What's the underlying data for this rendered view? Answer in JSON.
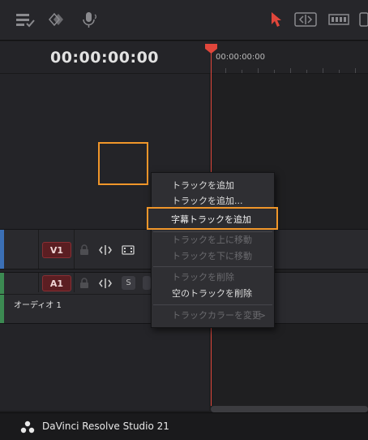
{
  "toolbar": {
    "icons": [
      "timeline-view-options-icon",
      "keyframe-diamond-icon",
      "voice-over-mic-icon",
      "selection-pointer-icon",
      "trim-edit-icon",
      "dynamic-trim-icon",
      "blade-icon"
    ]
  },
  "viewer": {
    "timecode": "00:00:00:00",
    "ruler_start_timecode": "00:00:00:00"
  },
  "tracks": {
    "video": {
      "badge": "V1",
      "color": "#3b6fb5"
    },
    "audio": {
      "badge": "A1",
      "solo_label": "S",
      "name": "オーディオ 1",
      "color": "#3c8a52"
    }
  },
  "context_menu": {
    "items": [
      {
        "label": "トラックを追加",
        "enabled": true
      },
      {
        "label": "トラックを追加...",
        "enabled": true
      },
      {
        "label": "字幕トラックを追加",
        "enabled": true,
        "highlighted": true
      },
      {
        "label": "トラックを上に移動",
        "enabled": false
      },
      {
        "label": "トラックを下に移動",
        "enabled": false
      },
      {
        "label": "トラックを削除",
        "enabled": false
      },
      {
        "label": "空のトラックを削除",
        "enabled": true
      },
      {
        "label": "トラックカラーを変更",
        "enabled": false
      }
    ],
    "submenu_arrow": ">"
  },
  "status_bar": {
    "app_name": "DaVinci Resolve Studio 21"
  },
  "colors": {
    "accent_orange": "#f0962a",
    "playhead_red": "#e0463b",
    "track_badge_red": "#5b1e22"
  }
}
